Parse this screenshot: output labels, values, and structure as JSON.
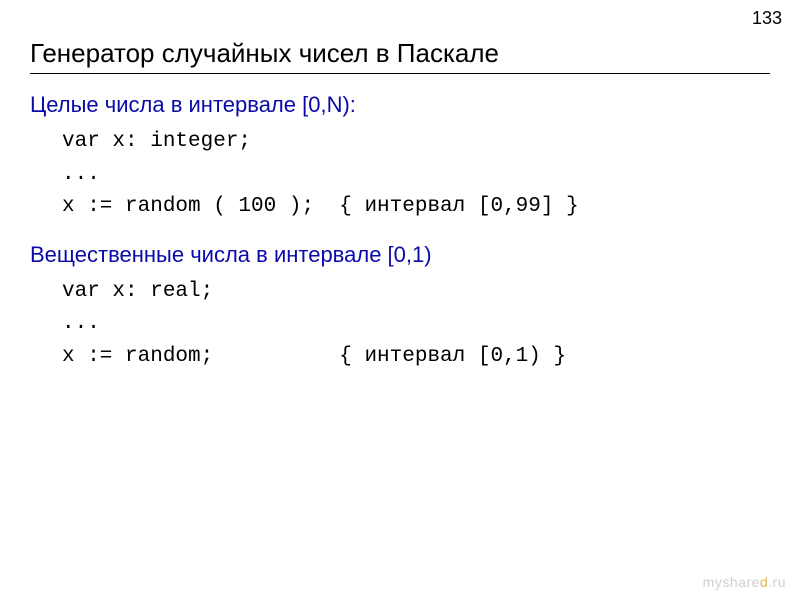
{
  "page_number": "133",
  "title": "Генератор случайных чисел в Паскале",
  "section1": {
    "heading": "Целые числа в интервале [0,N):",
    "code_line1": "var x: integer;",
    "code_line2": "...",
    "code_line3": "x := random ( 100 );  { интервал [0,99] }"
  },
  "section2": {
    "heading": "Вещественные числа в интервале [0,1)",
    "code_line1": "var x: real;",
    "code_line2": "...",
    "code_line3": "x := random;          { интервал [0,1) }"
  },
  "watermark": {
    "prefix": "myshare",
    "accent": "d",
    "suffix": ".ru"
  }
}
